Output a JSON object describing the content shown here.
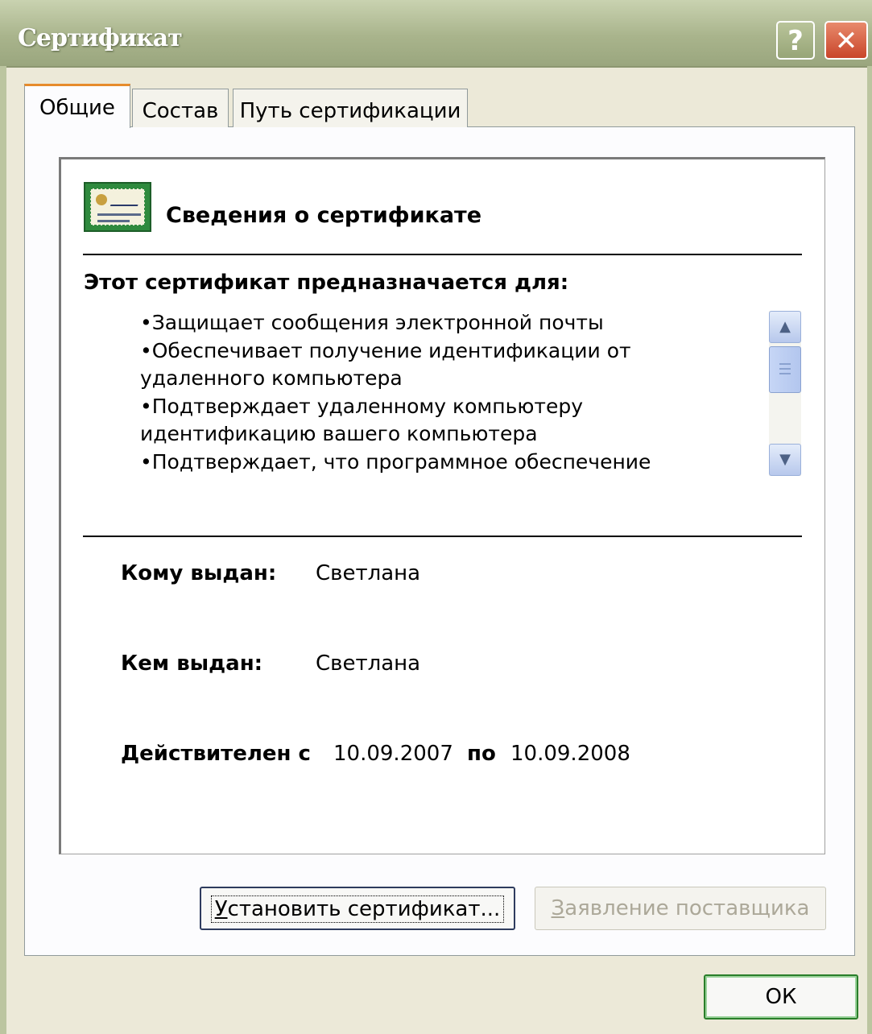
{
  "window": {
    "title": "Сертификат"
  },
  "titlebar": {
    "help_label": "?",
    "close_label": "✕"
  },
  "tabs": [
    {
      "label": "Общие",
      "active": true
    },
    {
      "label": "Состав",
      "active": false
    },
    {
      "label": "Путь сертификации",
      "active": false
    }
  ],
  "general": {
    "heading": "Сведения о сертификате",
    "purposes_title": "Этот сертификат предназначается для:",
    "purposes": [
      "•Защищает сообщения электронной почты",
      "•Обеспечивает получение идентификации от удаленного компьютера",
      "•Подтверждает удаленному компьютеру идентификацию вашего компьютера",
      "•Подтверждает, что программное обеспечение"
    ],
    "issued_to_label": "Кому выдан:",
    "issued_to_value": "Светлана",
    "issued_by_label": "Кем выдан:",
    "issued_by_value": "Светлана",
    "valid_from_label": "Действителен с",
    "valid_from_value": "10.09.2007",
    "valid_to_label": "по",
    "valid_to_value": "10.09.2008"
  },
  "scrollbar": {
    "up_glyph": "▲",
    "down_glyph": "▼"
  },
  "buttons": {
    "install_prefix": "У",
    "install_rest": "становить сертификат...",
    "issuer_statement_prefix": "З",
    "issuer_statement_rest": "аявление поставщика",
    "ok": "ОК"
  }
}
